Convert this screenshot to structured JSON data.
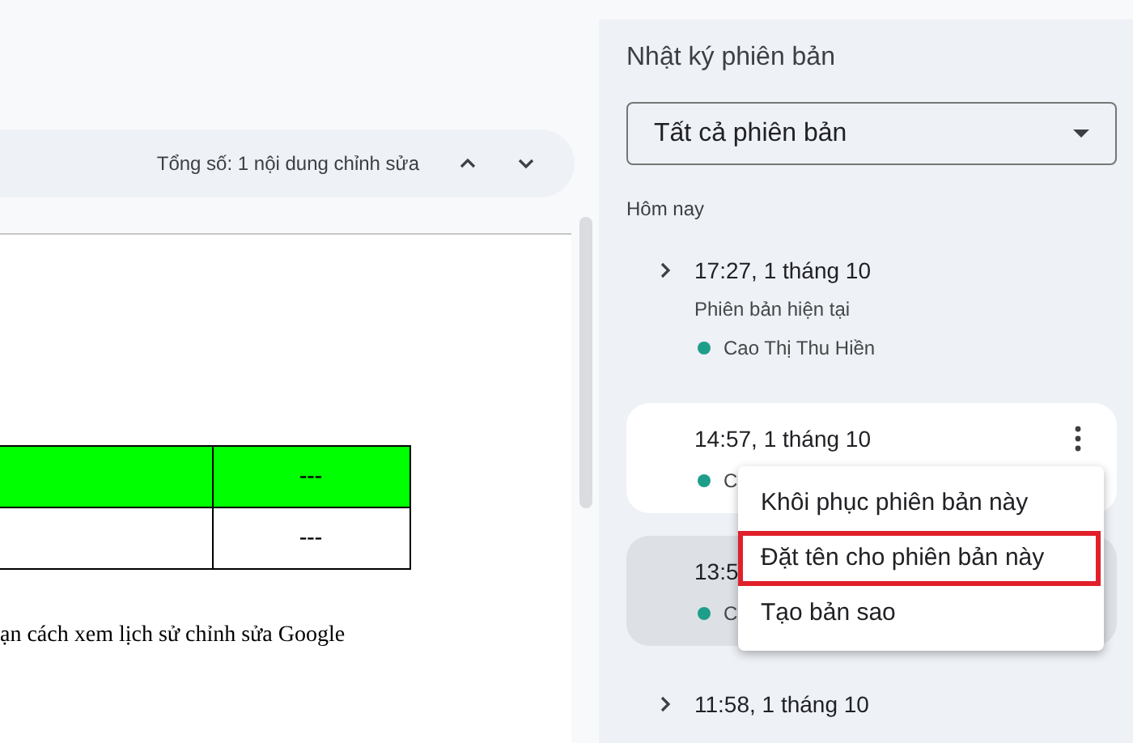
{
  "document": {
    "toolbar": {
      "summary": "Tổng số: 1 nội dung chỉnh sửa"
    },
    "table": {
      "rows": [
        {
          "highlighted": true,
          "cells": [
            "---"
          ]
        },
        {
          "highlighted": false,
          "cells": [
            "---"
          ]
        }
      ]
    },
    "paragraph": "ạn cách xem lịch sử chỉnh sửa Google"
  },
  "panel": {
    "title": "Nhật ký phiên bản",
    "filter": {
      "value": "Tất cả phiên bản"
    },
    "section": "Hôm nay",
    "versions": [
      {
        "time": "17:27, 1 tháng 10",
        "has_children": true,
        "subtitle": "Phiên bản hiện tại",
        "author": "Cao Thị Thu Hiền",
        "color": "#1e9e8a",
        "hovered": false,
        "selected": false
      },
      {
        "time": "14:57, 1 tháng 10",
        "has_children": false,
        "author": "C",
        "color": "#1e9e8a",
        "hovered": true,
        "selected": false
      },
      {
        "time": "13:5",
        "has_children": false,
        "author": "C",
        "color": "#1e9e8a",
        "hovered": false,
        "selected": true
      },
      {
        "time": "11:58, 1 tháng 10",
        "has_children": true,
        "hovered": false,
        "selected": false
      }
    ],
    "menu": {
      "items": [
        {
          "label": "Khôi phục phiên bản này",
          "highlighted": false
        },
        {
          "label": "Đặt tên cho phiên bản này",
          "highlighted": true
        },
        {
          "label": "Tạo bản sao",
          "highlighted": false
        }
      ]
    }
  }
}
